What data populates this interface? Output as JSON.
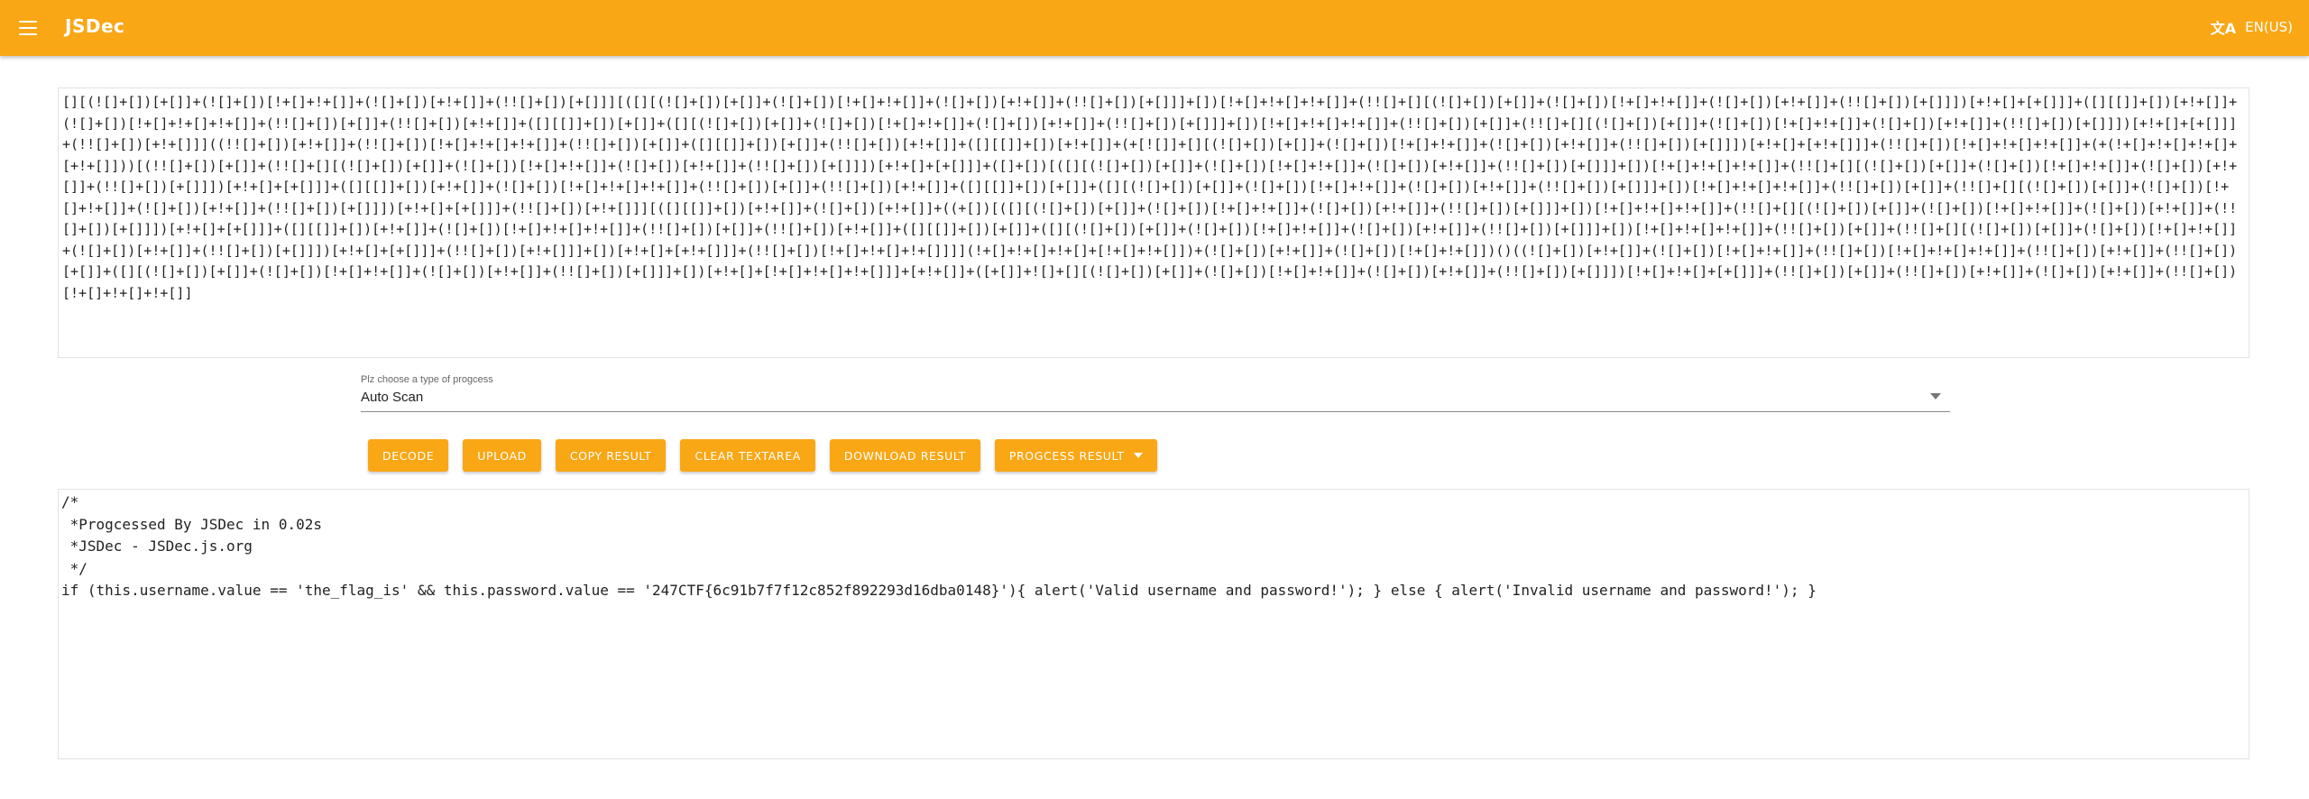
{
  "appbar": {
    "brand": "JSDec",
    "language": "EN(US)"
  },
  "icons": {
    "menu": "menu-icon",
    "translate": "translate-icon",
    "caret": "caret-down-icon"
  },
  "colors": {
    "accent": "#f9a715",
    "on_accent": "#ffffff"
  },
  "input": {
    "value": "[][(![]+[])[+[]]+(![]+[])[!+[]+!+[]]+(![]+[])[+!+[]]+(!![]+[])[+[]]][([][(![]+[])[+[]]+(![]+[])[!+[]+!+[]]+(![]+[])[+!+[]]+(!![]+[])[+[]]]+[])[!+[]+!+[]+!+[]]+(!![]+[][(![]+[])[+[]]+(![]+[])[!+[]+!+[]]+(![]+[])[+!+[]]+(!![]+[])[+[]]])[+!+[]+[+[]]]+([][[]]+[])[+!+[]]+(![]+[])[!+[]+!+[]+!+[]]+(!![]+[])[+[]]+(!![]+[])[+!+[]]+([][[]]+[])[+[]]+([][(![]+[])[+[]]+(![]+[])[!+[]+!+[]]+(![]+[])[+!+[]]+(!![]+[])[+[]]]+[])[!+[]+!+[]+!+[]]+(!![]+[])[+[]]+(!![]+[][(![]+[])[+[]]+(![]+[])[!+[]+!+[]]+(![]+[])[+!+[]]+(!![]+[])[+[]]])[+!+[]+[+[]]]+(!![]+[])[+!+[]]]((!![]+[])[+!+[]]+(!![]+[])[!+[]+!+[]+!+[]]+(!![]+[])[+[]]+([][[]]+[])[+[]]+(!![]+[])[+!+[]]+([][[]]+[])[+!+[]]+(+[![]]+[][(![]+[])[+[]]+(![]+[])[!+[]+!+[]]+(![]+[])[+!+[]]+(!![]+[])[+[]]])[+!+[]+[+!+[]]]+(!![]+[])[!+[]+!+[]+!+[]]+(+(!+[]+!+[]+!+[]+[+!+[]]))[(!![]+[])[+[]]+(!![]+[][(![]+[])[+[]]+(![]+[])[!+[]+!+[]]+(![]+[])[+!+[]]+(!![]+[])[+[]]])[+!+[]+[+[]]]+([]+[])[([][(![]+[])[+[]]+(![]+[])[!+[]+!+[]]+(![]+[])[+!+[]]+(!![]+[])[+[]]]+[])[!+[]+!+[]+!+[]]+(!![]+[][(![]+[])[+[]]+(![]+[])[!+[]+!+[]]+(![]+[])[+!+[]]+(!![]+[])[+[]]])[+!+[]+[+[]]]+([][[]]+[])[+!+[]]+(![]+[])[!+[]+!+[]+!+[]]+(!![]+[])[+[]]+(!![]+[])[+!+[]]+([][[]]+[])[+[]]+([][(![]+[])[+[]]+(![]+[])[!+[]+!+[]]+(![]+[])[+!+[]]+(!![]+[])[+[]]]+[])[!+[]+!+[]+!+[]]+(!![]+[])[+[]]+(!![]+[][(![]+[])[+[]]+(![]+[])[!+[]+!+[]]+(![]+[])[+!+[]]+(!![]+[])[+[]]])[+!+[]+[+[]]]+(!![]+[])[+!+[]]][([][[]]+[])[+!+[]]+(![]+[])[+!+[]]+((+[])[([][(![]+[])[+[]]+(![]+[])[!+[]+!+[]]+(![]+[])[+!+[]]+(!![]+[])[+[]]]+[])[!+[]+!+[]+!+[]]+(!![]+[][(![]+[])[+[]]+(![]+[])[!+[]+!+[]]+(![]+[])[+!+[]]+(!![]+[])[+[]]])[+!+[]+[+[]]]+([][[]]+[])[+!+[]]+(![]+[])[!+[]+!+[]+!+[]]+(!![]+[])[+[]]+(!![]+[])[+!+[]]+([][[]]+[])[+[]]+([][(![]+[])[+[]]+(![]+[])[!+[]+!+[]]+(![]+[])[+!+[]]+(!![]+[])[+[]]]+[])[!+[]+!+[]+!+[]]+(!![]+[])[+[]]+(!![]+[][(![]+[])[+[]]+(![]+[])[!+[]+!+[]]+(![]+[])[+!+[]]+(!![]+[])[+[]]])[+!+[]+[+[]]]+(!![]+[])[+!+[]]]+[])[+!+[]+[+!+[]]]+(!![]+[])[!+[]+!+[]+!+[]]]](!+[]+!+[]+!+[]+[!+[]+!+[]])+(![]+[])[+!+[]]+(![]+[])[!+[]+!+[]])()((![]+[])[+!+[]]+(![]+[])[!+[]+!+[]]+(!![]+[])[!+[]+!+[]+!+[]]+(!![]+[])[+!+[]]+(!![]+[])[+[]]+([][(![]+[])[+[]]+(![]+[])[!+[]+!+[]]+(![]+[])[+!+[]]+(!![]+[])[+[]]]+[])[+!+[]+[!+[]+!+[]+!+[]]]+[+!+[]]+([+[]]+![]+[][(![]+[])[+[]]+(![]+[])[!+[]+!+[]]+(![]+[])[+!+[]]+(!![]+[])[+[]]])[!+[]+!+[]+[+[]]]+(!![]+[])[+[]]+(!![]+[])[+!+[]]+(![]+[])[+!+[]]+(!![]+[])[!+[]+!+[]+!+[]]"
  },
  "process_select": {
    "label": "Plz choose a type of progcess",
    "value": "Auto Scan"
  },
  "toolbar": {
    "decode": "DECODE",
    "upload": "UPLOAD",
    "copy": "COPY RESULT",
    "clear": "CLEAR TEXTAREA",
    "download": "DOWNLOAD RESULT",
    "process_result": "PROGCESS RESULT"
  },
  "output": {
    "value": "/*\n *Progcessed By JSDec in 0.02s\n *JSDec - JSDec.js.org\n */\nif (this.username.value == 'the_flag_is' && this.password.value == '247CTF{6c91b7f7f12c852f892293d16dba0148}'){ alert('Valid username and password!'); } else { alert('Invalid username and password!'); }"
  }
}
